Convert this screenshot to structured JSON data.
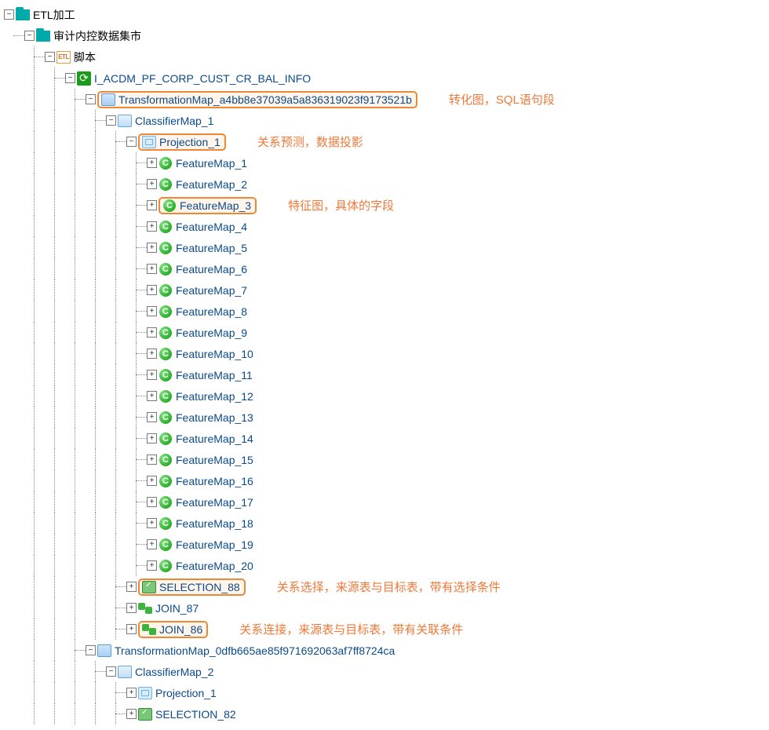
{
  "tree": {
    "root": "ETL加工",
    "sub1": "审计内控数据集市",
    "sub2": "脚本",
    "sub3": "I_ACDM_PF_CORP_CUST_CR_BAL_INFO",
    "tmap1": "TransformationMap_a4bb8e37039a5a836319023f9173521b",
    "cmap1": "ClassifierMap_1",
    "proj1": "Projection_1",
    "features": [
      "FeatureMap_1",
      "FeatureMap_2",
      "FeatureMap_3",
      "FeatureMap_4",
      "FeatureMap_5",
      "FeatureMap_6",
      "FeatureMap_7",
      "FeatureMap_8",
      "FeatureMap_9",
      "FeatureMap_10",
      "FeatureMap_11",
      "FeatureMap_12",
      "FeatureMap_13",
      "FeatureMap_14",
      "FeatureMap_15",
      "FeatureMap_16",
      "FeatureMap_17",
      "FeatureMap_18",
      "FeatureMap_19",
      "FeatureMap_20"
    ],
    "sel88": "SELECTION_88",
    "join87": "JOIN_87",
    "join86": "JOIN_86",
    "tmap2": "TransformationMap_0dfb665ae85f971692063af7ff8724ca",
    "cmap2": "ClassifierMap_2",
    "proj2": "Projection_1",
    "sel82": "SELECTION_82"
  },
  "annotations": {
    "tmap": "转化图，SQL语句段",
    "proj": "关系预测，数据投影",
    "feat": "特征图，具体的字段",
    "sel": "关系选择，来源表与目标表，带有选择条件",
    "join": "关系连接，来源表与目标表，带有关联条件"
  },
  "glyphs": {
    "plus": "+",
    "minus": "−",
    "etl": "ETL",
    "c": "C",
    "refresh": "⟳"
  }
}
